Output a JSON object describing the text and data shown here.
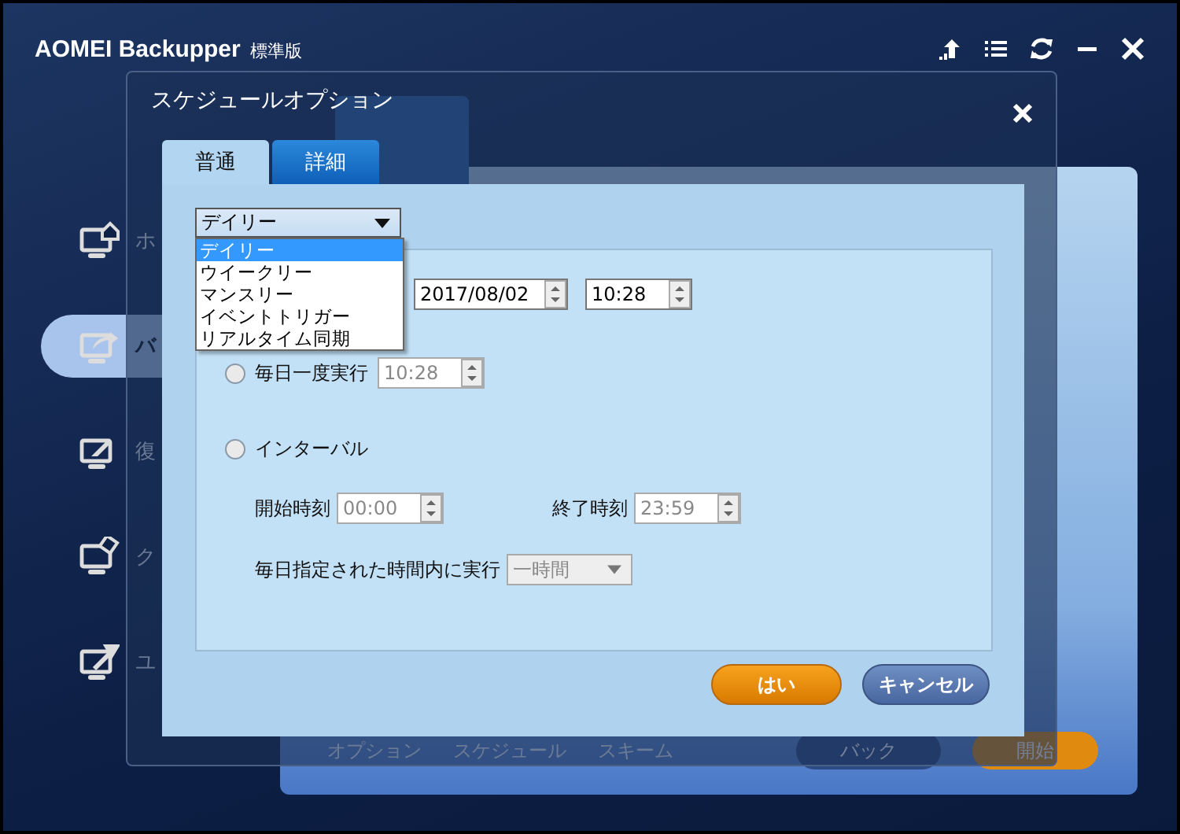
{
  "app": {
    "title": "AOMEI Backupper",
    "edition": "標準版"
  },
  "sidebar": {
    "items": [
      {
        "label": "ホ",
        "selected": false
      },
      {
        "label": "バ",
        "selected": true
      },
      {
        "label": "復",
        "selected": false
      },
      {
        "label": "ク",
        "selected": false
      },
      {
        "label": "ユ",
        "selected": false
      }
    ]
  },
  "background": {
    "footer_links": [
      "オプション",
      "スケジュール",
      "スキーム"
    ],
    "back_button": "バック",
    "start_button": "開始"
  },
  "dialog": {
    "title": "スケジュールオプション",
    "tabs": [
      {
        "label": "普通",
        "selected": true
      },
      {
        "label": "詳細",
        "selected": false
      }
    ],
    "frequency": {
      "value": "デイリー",
      "expanded": true,
      "options": [
        {
          "label": "デイリー",
          "selected": true
        },
        {
          "label": "ウイークリー",
          "selected": false
        },
        {
          "label": "マンスリー",
          "selected": false
        },
        {
          "label": "イベントトリガー",
          "selected": false
        },
        {
          "label": "リアルタイム同期",
          "selected": false
        }
      ]
    },
    "date": "2017/08/02",
    "time": "10:28",
    "once_daily": {
      "label": "毎日一度実行",
      "selected": false,
      "time": "10:28",
      "disabled": true
    },
    "interval": {
      "label": "インターバル",
      "selected": false,
      "start_label": "開始時刻",
      "start": "00:00",
      "end_label": "終了時刻",
      "end": "23:59",
      "repeat_label": "毎日指定された時間内に実行",
      "repeat": "一時間",
      "disabled": true
    },
    "buttons": [
      {
        "label": "はい",
        "kind": "primary"
      },
      {
        "label": "キャンセル",
        "kind": "secondary"
      }
    ]
  }
}
